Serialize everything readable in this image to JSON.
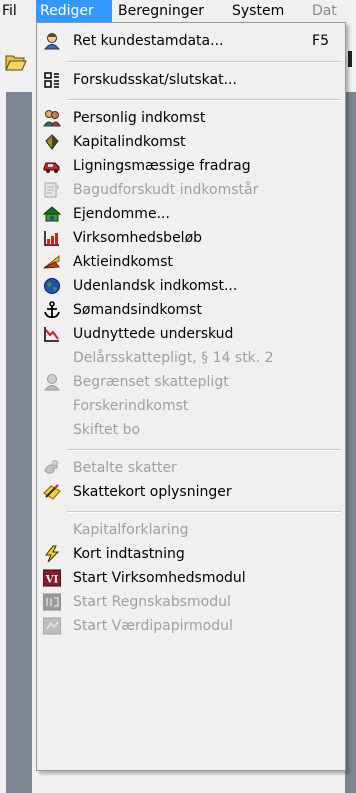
{
  "menubar": {
    "items": [
      "Fil",
      "Rediger",
      "Beregninger",
      "System",
      "Dat"
    ]
  },
  "menu": {
    "items": [
      {
        "label": "Ret kundestamdata...",
        "shortcut": "F5",
        "icon": "user-icon",
        "enabled": true
      },
      {
        "label": "Forskudsskat/slutskat...",
        "icon": "form-icon",
        "enabled": true
      },
      {
        "label": "Personlig indkomst",
        "icon": "people-icon",
        "enabled": true
      },
      {
        "label": "Kapitalindkomst",
        "icon": "capital-icon",
        "enabled": true
      },
      {
        "label": "Ligningsmæssige fradrag",
        "icon": "car-icon",
        "enabled": true
      },
      {
        "label": "Bagudforskudt indkomstår",
        "icon": "document-icon",
        "enabled": false
      },
      {
        "label": "Ejendomme...",
        "icon": "house-icon",
        "enabled": true
      },
      {
        "label": "Virksomhedsbeløb",
        "icon": "chart-icon",
        "enabled": true
      },
      {
        "label": "Aktieindkomst",
        "icon": "stock-icon",
        "enabled": true
      },
      {
        "label": "Udenlandsk indkomst...",
        "icon": "globe-icon",
        "enabled": true
      },
      {
        "label": "Sømandsindkomst",
        "icon": "anchor-icon",
        "enabled": true
      },
      {
        "label": "Uudnyttede underskud",
        "icon": "deficit-chart-icon",
        "enabled": true
      },
      {
        "label": "Delårsskattepligt, § 14 stk. 2",
        "enabled": false
      },
      {
        "label": "Begrænset skattepligt",
        "icon": "person-gray-icon",
        "enabled": false
      },
      {
        "label": "Forskerindkomst",
        "enabled": false
      },
      {
        "label": "Skiftet bo",
        "enabled": false
      },
      {
        "label": "Betalte skatter",
        "icon": "hand-icon",
        "enabled": false
      },
      {
        "label": "Skattekort oplysninger",
        "icon": "tax-card-icon",
        "enabled": true
      },
      {
        "label": "Kapitalforklaring",
        "enabled": false
      },
      {
        "label": "Kort indtastning",
        "icon": "lightning-icon",
        "enabled": true
      },
      {
        "label": "Start Virksomhedsmodul",
        "icon": "vi-icon",
        "icon_text": "VI",
        "enabled": true
      },
      {
        "label": "Start Regnskabsmodul",
        "icon": "accounting-icon",
        "enabled": false
      },
      {
        "label": "Start Værdipapirmodul",
        "icon": "securities-icon",
        "enabled": false
      }
    ]
  },
  "colors": {
    "highlight": "#3399ff",
    "disabled_text": "#a0a0a0",
    "app_background": "#7d8592"
  }
}
